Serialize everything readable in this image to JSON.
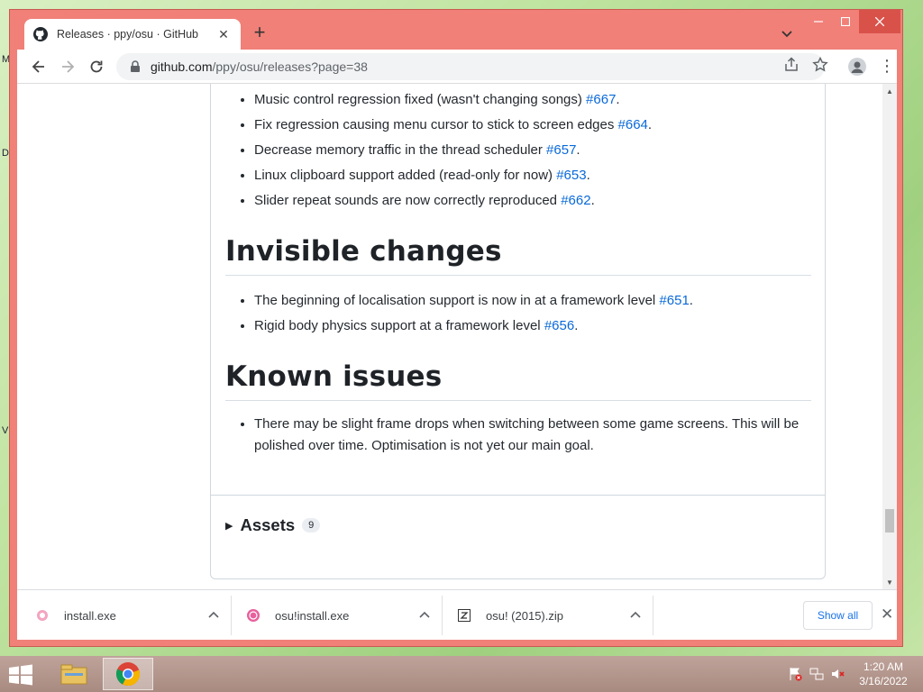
{
  "browser": {
    "tab_title": "Releases · ppy/osu · GitHub",
    "tab_close": "✕",
    "new_tab": "+",
    "url_host": "github.com",
    "url_path": "/ppy/osu/releases?page=38"
  },
  "page": {
    "bullets_top": [
      {
        "text": "Music control regression fixed (wasn't changing songs) ",
        "link": "#667",
        "after": "."
      },
      {
        "text": "Fix regression causing menu cursor to stick to screen edges ",
        "link": "#664",
        "after": "."
      },
      {
        "text": "Decrease memory traffic in the thread scheduler ",
        "link": "#657",
        "after": "."
      },
      {
        "text": "Linux clipboard support added (read-only for now) ",
        "link": "#653",
        "after": "."
      },
      {
        "text": "Slider repeat sounds are now correctly reproduced ",
        "link": "#662",
        "after": "."
      }
    ],
    "heading_invisible": "Invisible changes",
    "bullets_invisible": [
      {
        "text": "The beginning of localisation support is now in at a framework level ",
        "link": "#651",
        "after": "."
      },
      {
        "text": "Rigid body physics support at a framework level ",
        "link": "#656",
        "after": "."
      }
    ],
    "heading_known": "Known issues",
    "bullets_known": [
      {
        "text": "There may be slight frame drops when switching between some game screens. This will be polished over time. Optimisation is not yet our main goal."
      }
    ],
    "assets_label": "Assets",
    "assets_count": "9"
  },
  "downloads": {
    "items": [
      {
        "name": "install.exe"
      },
      {
        "name": "osu!install.exe"
      },
      {
        "name": "osu! (2015).zip"
      }
    ],
    "show_all": "Show all",
    "close": "✕"
  },
  "taskbar": {
    "time": "1:20 AM",
    "date": "3/16/2022"
  },
  "colors": {
    "window_frame": "#f08078",
    "link": "#0969da"
  }
}
